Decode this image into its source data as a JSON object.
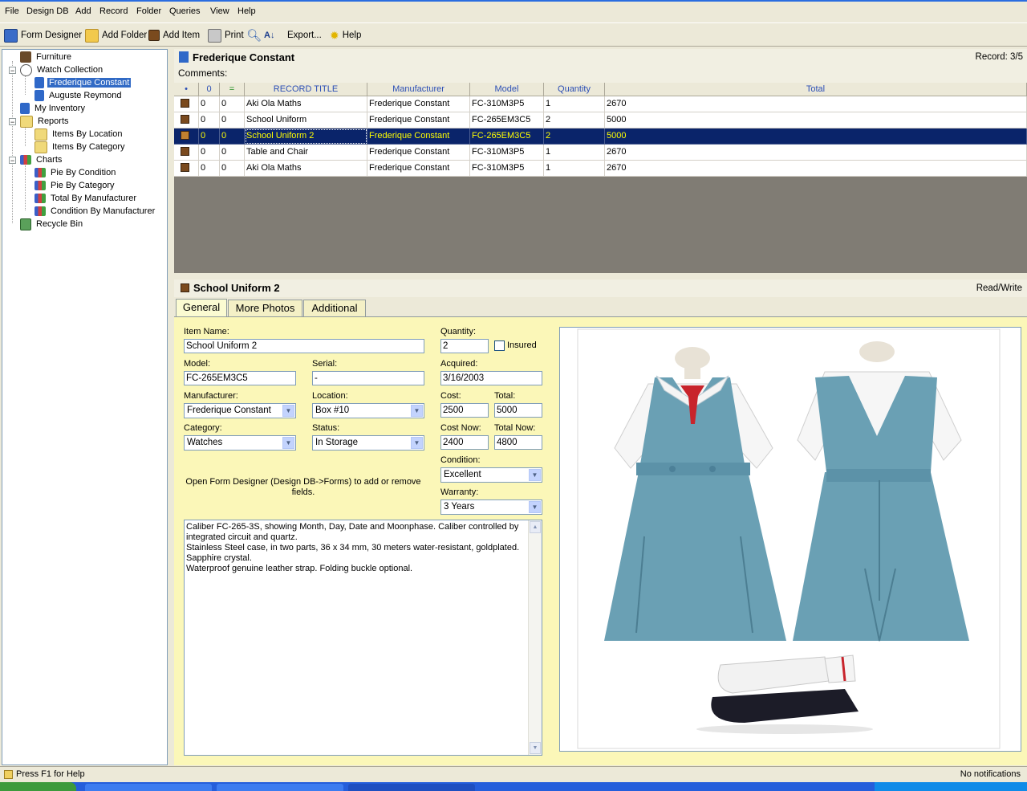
{
  "menu": [
    "File",
    "Design DB",
    "Add",
    "Record",
    "Folder",
    "Queries",
    "View",
    "Help"
  ],
  "toolbar": {
    "form_designer": "Form Designer",
    "add_folder": "Add Folder",
    "add_item": "Add Item",
    "print": "Print",
    "export": "Export...",
    "help": "Help"
  },
  "tree": {
    "furniture": "Furniture",
    "watch_collection": "Watch Collection",
    "frederique": "Frederique Constant",
    "auguste": "Auguste Reymond",
    "my_inventory": "My Inventory",
    "reports": "Reports",
    "items_by_location": "Items By Location",
    "items_by_category": "Items By Category",
    "charts": "Charts",
    "pie_by_condition": "Pie By Condition",
    "pie_by_category": "Pie By Category",
    "total_by_manufacturer": "Total By Manufacturer",
    "condition_by_manufacturer": "Condition By Manufacturer",
    "recycle_bin": "Recycle Bin"
  },
  "record_header": {
    "title": "Frederique Constant",
    "record_label": "Record: 3/5",
    "comments": "Comments:"
  },
  "grid": {
    "headers": [
      "•",
      "0",
      "=",
      "RECORD TITLE",
      "Manufacturer",
      "Model",
      "Quantity",
      "Total"
    ],
    "rows": [
      {
        "a": "0",
        "b": "0",
        "title": "Aki Ola Maths",
        "manufacturer": "Frederique Constant",
        "model": "FC-310M3P5",
        "quantity": "1",
        "total": "2670"
      },
      {
        "a": "0",
        "b": "0",
        "title": "School Uniform",
        "manufacturer": "Frederique Constant",
        "model": "FC-265EM3C5",
        "quantity": "2",
        "total": "5000"
      },
      {
        "a": "0",
        "b": "0",
        "title": "School Uniform 2",
        "manufacturer": "Frederique Constant",
        "model": "FC-265EM3C5",
        "quantity": "2",
        "total": "5000"
      },
      {
        "a": "0",
        "b": "0",
        "title": "Table and Chair",
        "manufacturer": "Frederique Constant",
        "model": "FC-310M3P5",
        "quantity": "1",
        "total": "2670"
      },
      {
        "a": "0",
        "b": "0",
        "title": "Aki Ola Maths",
        "manufacturer": "Frederique Constant",
        "model": "FC-310M3P5",
        "quantity": "1",
        "total": "2670"
      }
    ]
  },
  "detail": {
    "title": "School Uniform 2",
    "mode": "Read/Write",
    "tabs": [
      "General",
      "More Photos",
      "Additional"
    ]
  },
  "form": {
    "item_name_label": "Item Name:",
    "item_name": "School Uniform 2",
    "model_label": "Model:",
    "model": "FC-265EM3C5",
    "serial_label": "Serial:",
    "serial": "-",
    "manufacturer_label": "Manufacturer:",
    "manufacturer": "Frederique Constant",
    "location_label": "Location:",
    "location": "Box #10",
    "category_label": "Category:",
    "category": "Watches",
    "status_label": "Status:",
    "status": "In Storage",
    "quantity_label": "Quantity:",
    "quantity": "2",
    "insured_label": "Insured",
    "acquired_label": "Acquired:",
    "acquired": "3/16/2003",
    "cost_label": "Cost:",
    "cost": "2500",
    "total_label": "Total:",
    "total": "5000",
    "cost_now_label": "Cost Now:",
    "cost_now": "2400",
    "total_now_label": "Total Now:",
    "total_now": "4800",
    "condition_label": "Condition:",
    "condition": "Excellent",
    "warranty_label": "Warranty:",
    "warranty": "3 Years",
    "hint": "Open Form Designer (Design DB->Forms) to add or remove fields.",
    "notes": [
      "Caliber FC-265-3S, showing Month, Day, Date and Moonphase.  Caliber controlled by integrated circuit and quartz.",
      "Stainless Steel case, in two parts, 36 x 34 mm, 30 meters water-resistant, goldplated.",
      "Sapphire crystal.",
      "Waterproof genuine leather strap.  Folding buckle optional."
    ]
  },
  "status": {
    "left": "Press F1 for Help",
    "right": "No notifications"
  },
  "colors": {
    "selection": "#0a246a",
    "tree_selection": "#316ac5",
    "panel_bg": "#fbf7b8",
    "dress": "#6aa0b4"
  }
}
